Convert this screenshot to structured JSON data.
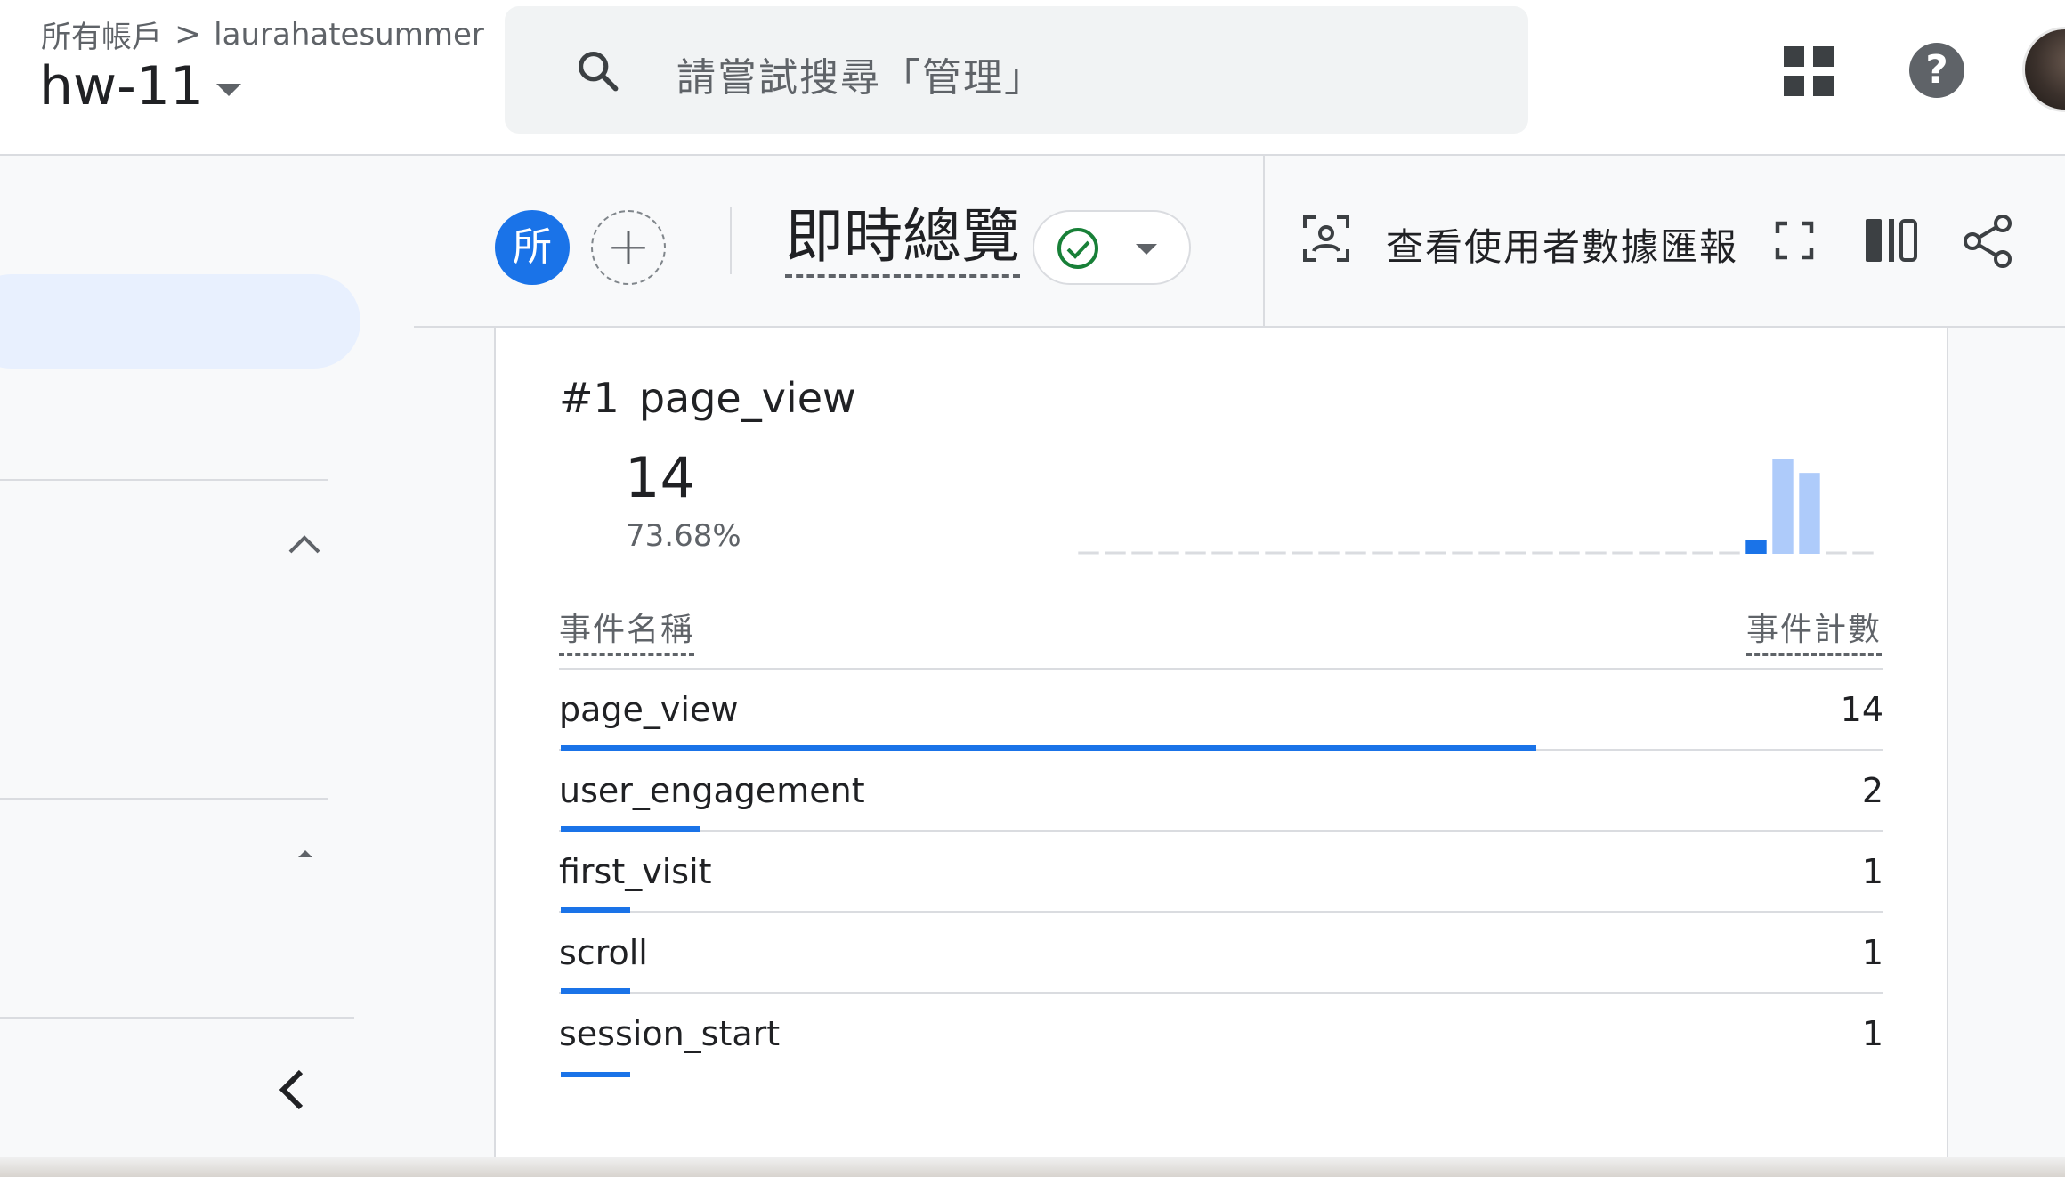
{
  "header": {
    "breadcrumb_root": "所有帳戶",
    "breadcrumb_separator": ">",
    "account": "laurahatesummer",
    "property": "hw-11",
    "search_placeholder": "請嘗試搜尋「管理」",
    "help_glyph": "?"
  },
  "toolbar": {
    "comparison_avatar": "所",
    "add_comparison": "+",
    "report_title": "即時總覽",
    "user_snapshot_label": "查看使用者數據匯報"
  },
  "card": {
    "rank": "#1",
    "event": "page_view",
    "value": "14",
    "percent": "73.68%",
    "col_name": "事件名稱",
    "col_count": "事件計數",
    "rows": [
      {
        "name": "page_view",
        "count": "14",
        "share": 0.7368
      },
      {
        "name": "user_engagement",
        "count": "2",
        "share": 0.1053
      },
      {
        "name": "first_visit",
        "count": "1",
        "share": 0.0526
      },
      {
        "name": "scroll",
        "count": "1",
        "share": 0.0526
      },
      {
        "name": "session_start",
        "count": "1",
        "share": 0.0526
      }
    ]
  },
  "chart_data": {
    "type": "bar",
    "title": "",
    "xlabel": "",
    "ylabel": "",
    "ylim": [
      0,
      14
    ],
    "values": [
      0,
      0,
      0,
      0,
      0,
      0,
      0,
      0,
      0,
      0,
      0,
      0,
      0,
      0,
      0,
      0,
      0,
      0,
      0,
      0,
      0,
      0,
      0,
      0,
      0,
      2,
      14,
      12,
      0,
      0
    ],
    "highlight_index": 25,
    "colors": {
      "highlight": "#1a73e8",
      "bar": "#aecbfa",
      "baseline": "#dadce0"
    }
  },
  "colors": {
    "accent": "#1a73e8",
    "success": "#188038",
    "sidebar_selected": "#e8f0fe"
  },
  "icons": [
    "search-icon",
    "apps-grid-icon",
    "help-icon",
    "chevron-up-icon",
    "collapse-triangle-icon",
    "chevron-left-icon",
    "check-circle-icon",
    "user-snapshot-icon",
    "fullscreen-icon",
    "columns-icon",
    "share-icon"
  ]
}
